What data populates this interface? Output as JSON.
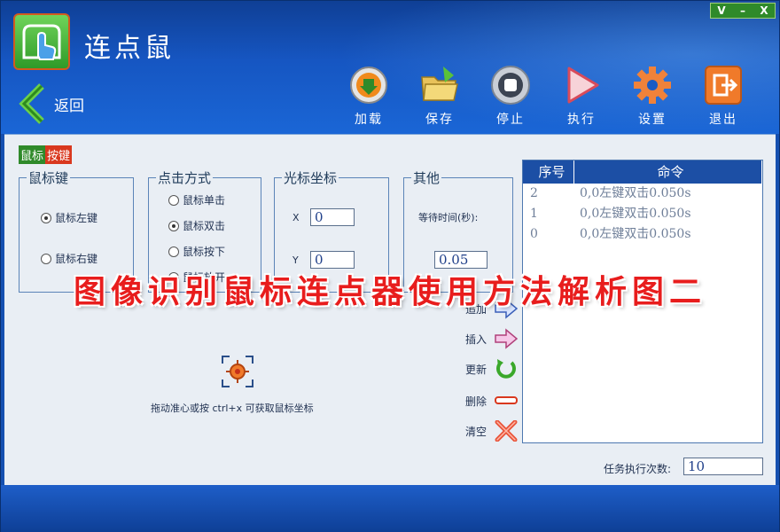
{
  "window": {
    "title": "连点鼠",
    "controls": [
      "V",
      "–",
      "X"
    ]
  },
  "nav": {
    "back_label": "返回"
  },
  "toolbar": [
    {
      "label": "加载",
      "icon": "load-icon"
    },
    {
      "label": "保存",
      "icon": "folder-save-icon"
    },
    {
      "label": "停止",
      "icon": "stop-icon"
    },
    {
      "label": "执行",
      "icon": "play-icon"
    },
    {
      "label": "设置",
      "icon": "gear-icon"
    },
    {
      "label": "退出",
      "icon": "exit-icon"
    }
  ],
  "section_tag": {
    "part1": "鼠标",
    "part2": "按键"
  },
  "mouse_key": {
    "title": "鼠标键",
    "options": [
      {
        "label": "鼠标左键",
        "selected": true
      },
      {
        "label": "鼠标右键",
        "selected": false
      }
    ]
  },
  "click_mode": {
    "title": "点击方式",
    "options": [
      {
        "label": "鼠标单击",
        "selected": false
      },
      {
        "label": "鼠标双击",
        "selected": true
      },
      {
        "label": "鼠标按下",
        "selected": false
      },
      {
        "label": "鼠标放开",
        "selected": false
      }
    ]
  },
  "cursor_coords": {
    "title": "光标坐标",
    "x_label": "X",
    "x_value": "0",
    "y_label": "Y",
    "y_value": "0"
  },
  "other": {
    "title": "其他",
    "wait_label": "等待时间(秒):",
    "wait_value": "0.05"
  },
  "target": {
    "hint": "拖动准心或按 ctrl+x 可获取鼠标坐标"
  },
  "commands": [
    {
      "label": "追加",
      "icon": "append-arrow-icon"
    },
    {
      "label": "插入",
      "icon": "insert-arrow-icon"
    },
    {
      "label": "更新",
      "icon": "refresh-icon"
    },
    {
      "label": "删除",
      "icon": "delete-icon"
    },
    {
      "label": "清空",
      "icon": "clear-icon"
    }
  ],
  "list": {
    "headers": [
      "序号",
      "命令"
    ],
    "rows": [
      {
        "index": "2",
        "command": "0,0左键双击0.050s"
      },
      {
        "index": "1",
        "command": "0,0左键双击0.050s"
      },
      {
        "index": "0",
        "command": "0,0左键双击0.050s"
      }
    ]
  },
  "task": {
    "label": "任务执行次数:",
    "value": "10"
  },
  "overlay_text": "图像识别鼠标连点器使用方法解析图二",
  "colors": {
    "header_blue": "#1656c2",
    "list_header": "#1c4fa5",
    "overlay_red": "#e81d1d",
    "tag_green": "#2f8a2a",
    "tag_red": "#d9381e"
  }
}
